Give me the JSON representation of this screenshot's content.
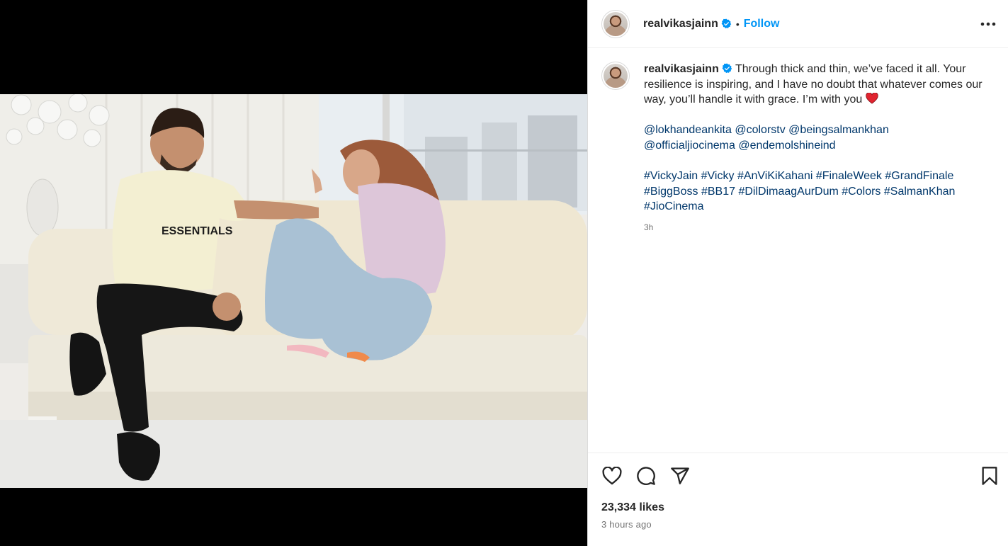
{
  "post": {
    "author": {
      "username": "realvikasjainn",
      "verified": true
    },
    "follow_label": "Follow",
    "separator": "•",
    "caption": {
      "text": "Through thick and thin, we’ve faced it all. Your resilience is inspiring, and I have no doubt that whatever comes our way, you’ll handle it with grace. I’m with you",
      "emoji": "red-heart",
      "mentions_line1": [
        "@lokhandeankita",
        "@colorstv",
        "@beingsalmankhan"
      ],
      "mentions_line2": [
        "@officialjiocinema",
        "@endemolshineind"
      ],
      "hashtags_line1": [
        "#VickyJain",
        "#Vicky",
        "#AnViKiKahani",
        "#FinaleWeek",
        "#GrandFinale"
      ],
      "hashtags_line2": [
        "#BiggBoss",
        "#BB17",
        "#DilDimaagAurDum",
        "#Colors",
        "#SalmanKhan"
      ],
      "hashtags_line3": [
        "#JioCinema"
      ],
      "relative_time": "3h"
    },
    "likes": "23,334 likes",
    "time_ago": "3 hours ago"
  },
  "icons": {
    "more": "more-options-icon",
    "like": "heart-icon",
    "comment": "comment-icon",
    "share": "share-icon",
    "save": "bookmark-icon",
    "tagged": "user-tag-icon"
  },
  "colors": {
    "link": "#00376b",
    "follow": "#0095f6",
    "verified": "#0095f6",
    "muted": "#737373"
  }
}
